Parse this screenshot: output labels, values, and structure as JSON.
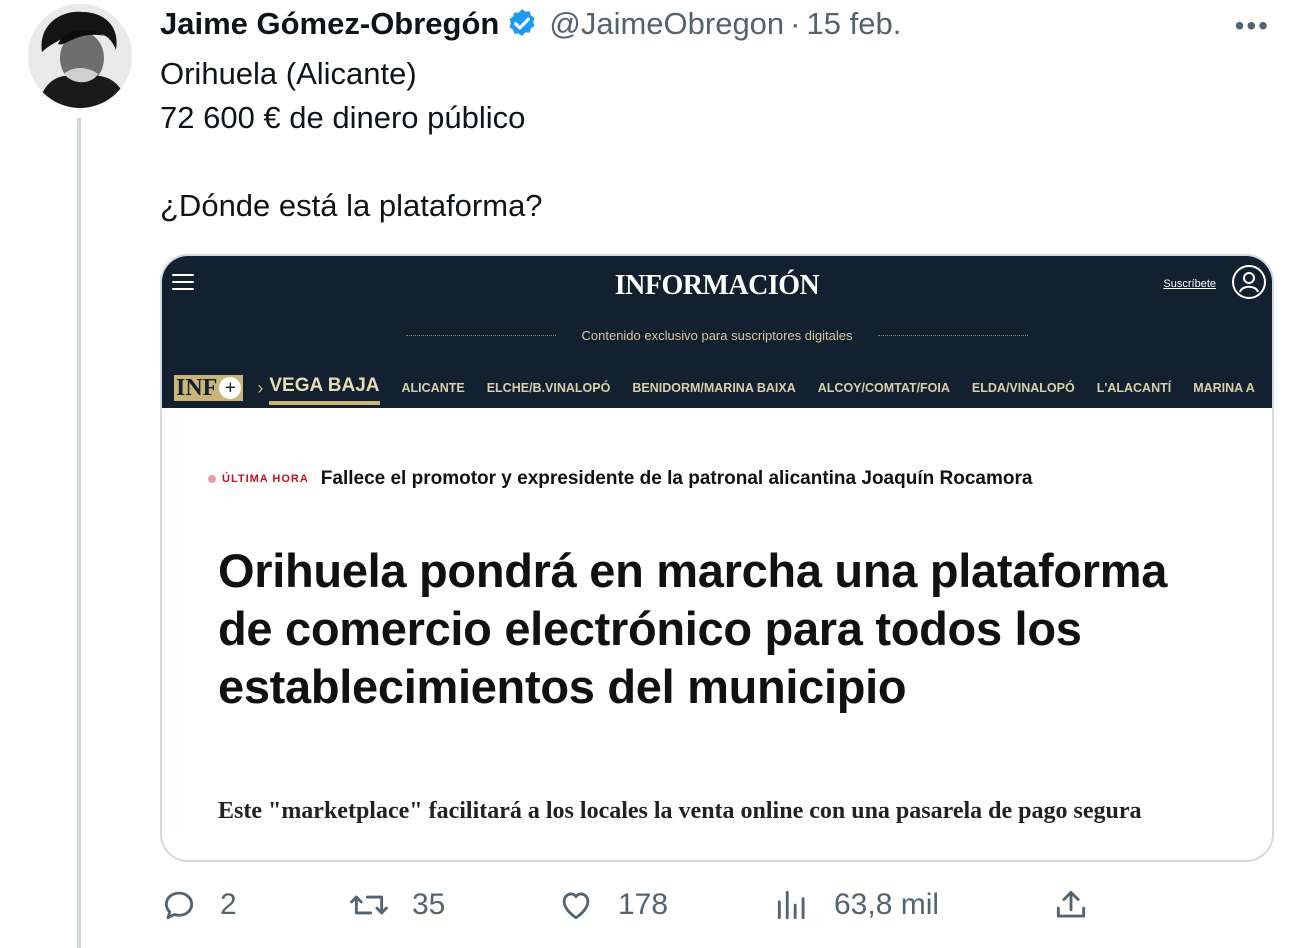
{
  "tweet": {
    "author_name": "Jaime Gómez-Obregón",
    "handle": "@JaimeObregon",
    "separator": "·",
    "date": "15 feb.",
    "more": "•••",
    "lines": [
      "Orihuela (Alicante)",
      "72 600 € de dinero público",
      "",
      "¿Dónde está la plataforma?"
    ]
  },
  "card": {
    "logo": "INFORMACIÓN",
    "subscribe": "Suscríbete",
    "exclusive": "Contenido exclusivo para suscriptores digitales",
    "nav": {
      "brand": "INF",
      "brand_plus": "+",
      "chevron": "›",
      "active": "VEGA BAJA",
      "items": [
        "ALICANTE",
        "ELCHE/B.VINALOPÓ",
        "BENIDORM/MARINA BAIXA",
        "ALCOY/COMTAT/FOIA",
        "ELDA/VINALOPÓ",
        "L'ALACANTÍ",
        "MARINA A"
      ]
    },
    "breaking_tag": "ÚLTIMA HORA",
    "breaking_text": "Fallece el promotor y expresidente de la patronal alicantina Joaquín Rocamora",
    "headline": "Orihuela pondrá en marcha una plataforma de comercio electrónico para todos los establecimientos del municipio",
    "subhead": "Este \"marketplace\" facilitará a los locales la venta online con una pasarela de pago segura"
  },
  "actions": {
    "replies": "2",
    "retweets": "35",
    "likes": "178",
    "views": "63,8 mil"
  },
  "colors": {
    "verified": "#1d9bf0",
    "muted": "#536471",
    "site_header": "#13202f",
    "site_accent": "#c9b578"
  }
}
